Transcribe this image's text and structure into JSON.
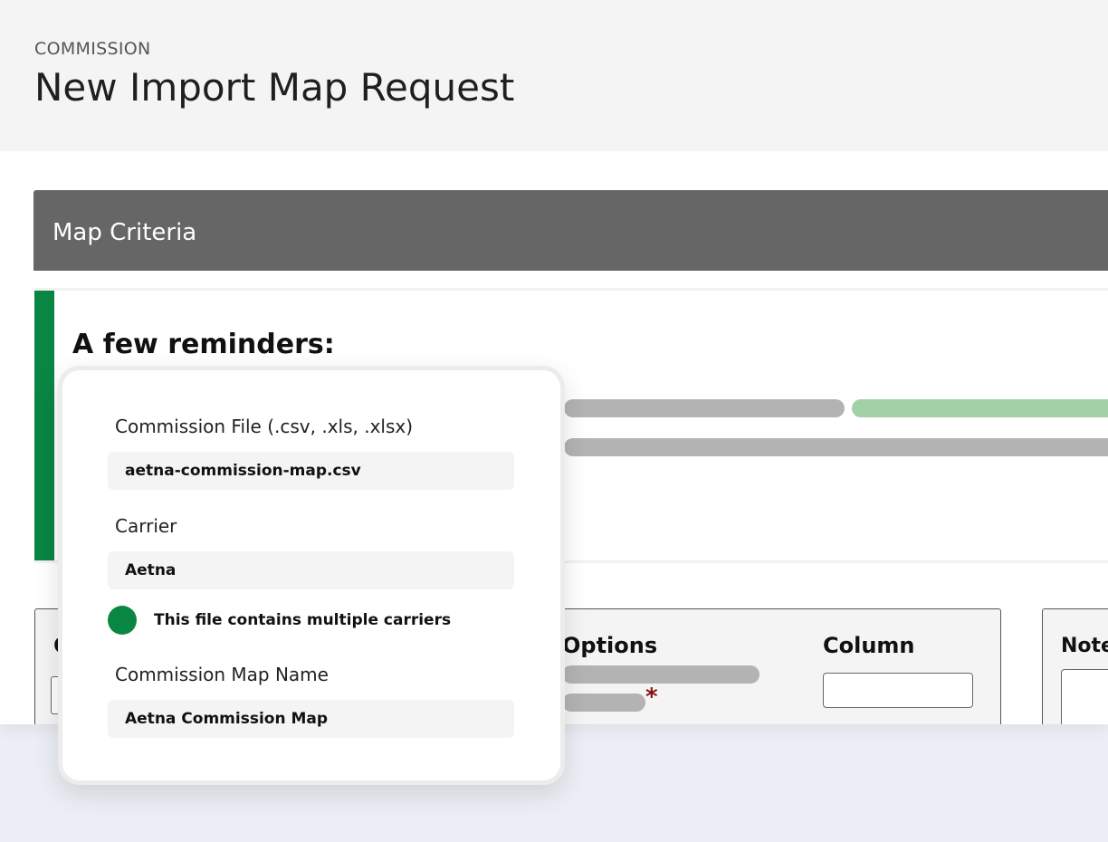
{
  "header": {
    "eyebrow": "COMMISSION",
    "title": "New Import Map Request"
  },
  "map_criteria": {
    "title": "Map Criteria"
  },
  "reminders": {
    "title": "A few reminders:"
  },
  "table": {
    "truncated_header": "C",
    "options_header": "Options",
    "column_header": "Column",
    "required_marker": "*",
    "notes_header": "Note"
  },
  "card": {
    "commission_file": {
      "label": "Commission File (.csv, .xls, .xlsx)",
      "value": "aetna-commission-map.csv"
    },
    "carrier": {
      "label": "Carrier",
      "value": "Aetna"
    },
    "multiple_carriers": {
      "label": "This file contains multiple carriers",
      "checked": true
    },
    "map_name": {
      "label": "Commission Map Name",
      "value": "Aetna Commission Map"
    }
  },
  "colors": {
    "accent": "#0a8643",
    "bar_grey": "#b3b3b3",
    "bar_green": "#a2d0a7",
    "section_header": "#666666",
    "required": "#8b1010"
  }
}
